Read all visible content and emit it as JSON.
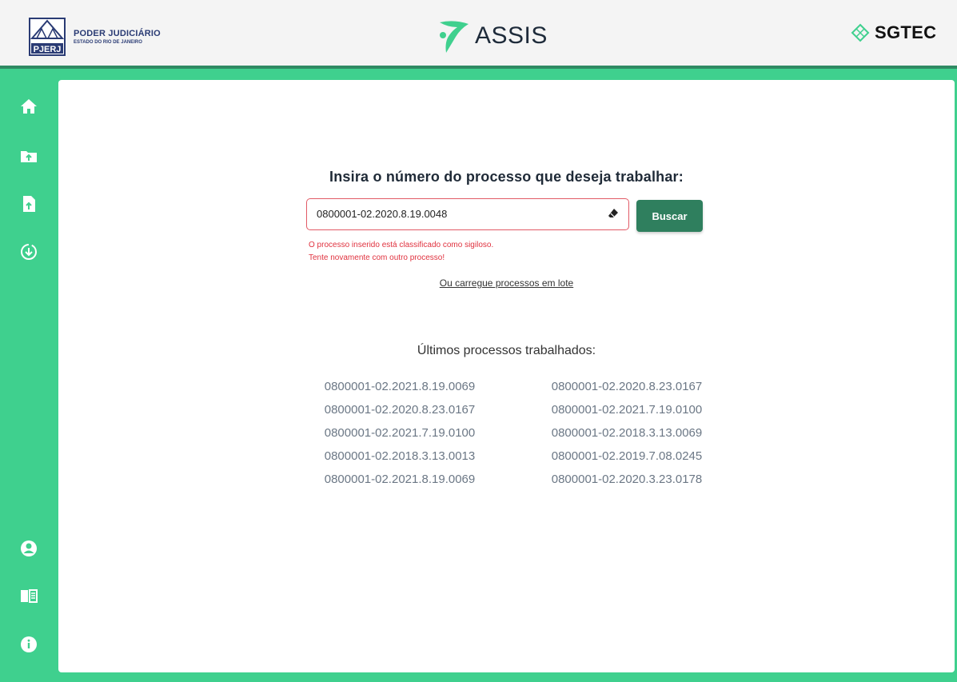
{
  "header": {
    "org_title": "PODER JUDICIÁRIO",
    "org_subtitle": "ESTADO DO RIO DE JANEIRO",
    "org_abbr": "PJERJ",
    "app_name": "ASSIS",
    "partner_name": "SGTEC"
  },
  "sidebar": {
    "items": [
      {
        "icon": "home-icon"
      },
      {
        "icon": "folder-upload-icon"
      },
      {
        "icon": "file-upload-icon"
      },
      {
        "icon": "download-circle-icon"
      },
      {
        "icon": "user-icon"
      },
      {
        "icon": "book-icon"
      },
      {
        "icon": "info-icon"
      }
    ]
  },
  "search": {
    "title": "Insira o número do processo que deseja trabalhar:",
    "value": "0800001-02.2020.8.19.0048",
    "button_label": "Buscar",
    "error_line1": "O processo inserido está classificado como sigiloso.",
    "error_line2": "Tente novamente com outro processo!",
    "batch_link": "Ou carregue processos em lote"
  },
  "recent": {
    "title": "Últimos processos trabalhados:",
    "left": [
      "0800001-02.2021.8.19.0069",
      "0800001-02.2020.8.23.0167",
      "0800001-02.2021.7.19.0100",
      "0800001-02.2018.3.13.0013",
      "0800001-02.2021.8.19.0069"
    ],
    "right": [
      "0800001-02.2020.8.23.0167",
      "0800001-02.2021.7.19.0100",
      "0800001-02.2018.3.13.0069",
      "0800001-02.2019.7.08.0245",
      "0800001-02.2020.3.23.0178"
    ]
  },
  "colors": {
    "sidebar_bg": "#3fd08e",
    "button_bg": "#2f7f5e",
    "error": "#e0323f"
  }
}
